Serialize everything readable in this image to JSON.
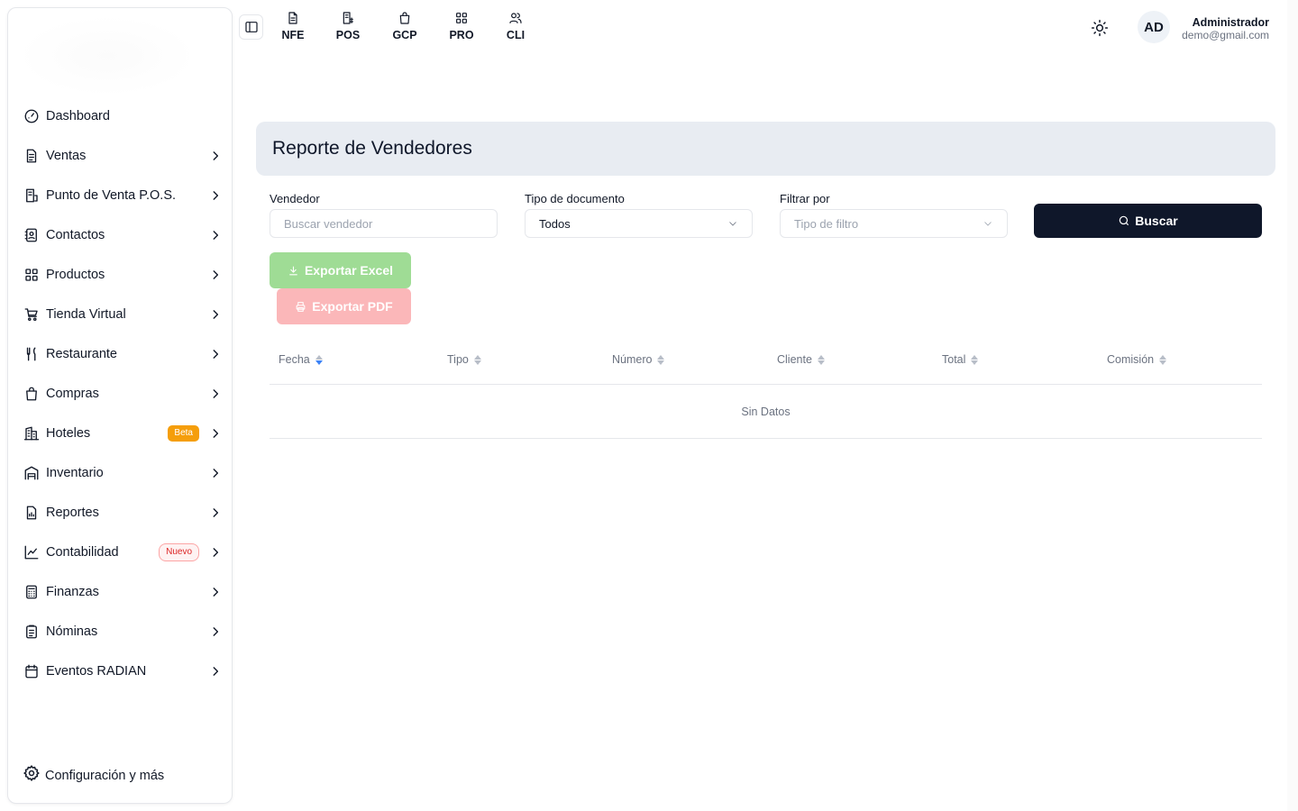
{
  "sidebar": {
    "items": [
      {
        "label": "Dashboard",
        "icon": "dashboard-icon",
        "chevron": false
      },
      {
        "label": "Ventas",
        "icon": "document-icon",
        "chevron": true
      },
      {
        "label": "Punto de Venta P.O.S.",
        "icon": "pos-receipt-icon",
        "chevron": true
      },
      {
        "label": "Contactos",
        "icon": "contacts-icon",
        "chevron": true
      },
      {
        "label": "Productos",
        "icon": "grid-icon",
        "chevron": true
      },
      {
        "label": "Tienda Virtual",
        "icon": "cart-icon",
        "chevron": true
      },
      {
        "label": "Restaurante",
        "icon": "utensils-icon",
        "chevron": true
      },
      {
        "label": "Compras",
        "icon": "shopping-bag-icon",
        "chevron": true
      },
      {
        "label": "Hoteles",
        "icon": "hotel-icon",
        "chevron": true,
        "badge": "Beta"
      },
      {
        "label": "Inventario",
        "icon": "warehouse-icon",
        "chevron": true
      },
      {
        "label": "Reportes",
        "icon": "report-icon",
        "chevron": true
      },
      {
        "label": "Contabilidad",
        "icon": "chart-icon",
        "chevron": true,
        "badge": "Nuevo"
      },
      {
        "label": "Finanzas",
        "icon": "calculator-icon",
        "chevron": true
      },
      {
        "label": "Nóminas",
        "icon": "clipboard-icon",
        "chevron": true
      },
      {
        "label": "Eventos RADIAN",
        "icon": "calendar-icon",
        "chevron": true
      }
    ],
    "settings_label": "Configuración y más"
  },
  "topbar": {
    "apps": [
      {
        "label": "NFE",
        "icon": "invoice-icon"
      },
      {
        "label": "POS",
        "icon": "pos-icon"
      },
      {
        "label": "GCP",
        "icon": "bag-icon"
      },
      {
        "label": "PRO",
        "icon": "grid-icon"
      },
      {
        "label": "CLI",
        "icon": "users-icon"
      }
    ],
    "user": {
      "initials": "AD",
      "name": "Administrador",
      "email": "demo@gmail.com"
    }
  },
  "main": {
    "title": "Reporte de Vendedores",
    "filters": {
      "vendedor": {
        "label": "Vendedor",
        "placeholder": "Buscar vendedor"
      },
      "tipo_documento": {
        "label": "Tipo de documento",
        "value": "Todos"
      },
      "filtrar_por": {
        "label": "Filtrar por",
        "placeholder": "Tipo de filtro"
      }
    },
    "buttons": {
      "search": "Buscar",
      "export_excel": "Exportar Excel",
      "export_pdf": "Exportar PDF"
    },
    "table": {
      "columns": [
        "Fecha",
        "Tipo",
        "Número",
        "Cliente",
        "Total",
        "Comisión"
      ],
      "empty_text": "Sin Datos"
    }
  },
  "colors": {
    "primary_dark": "#0f172a",
    "excel_green": "#9fdc95",
    "pdf_red": "#fbb7b9",
    "header_bg": "#e8ecf2",
    "beta_badge": "#f59e0b",
    "nuevo_badge": "#dc2626"
  }
}
